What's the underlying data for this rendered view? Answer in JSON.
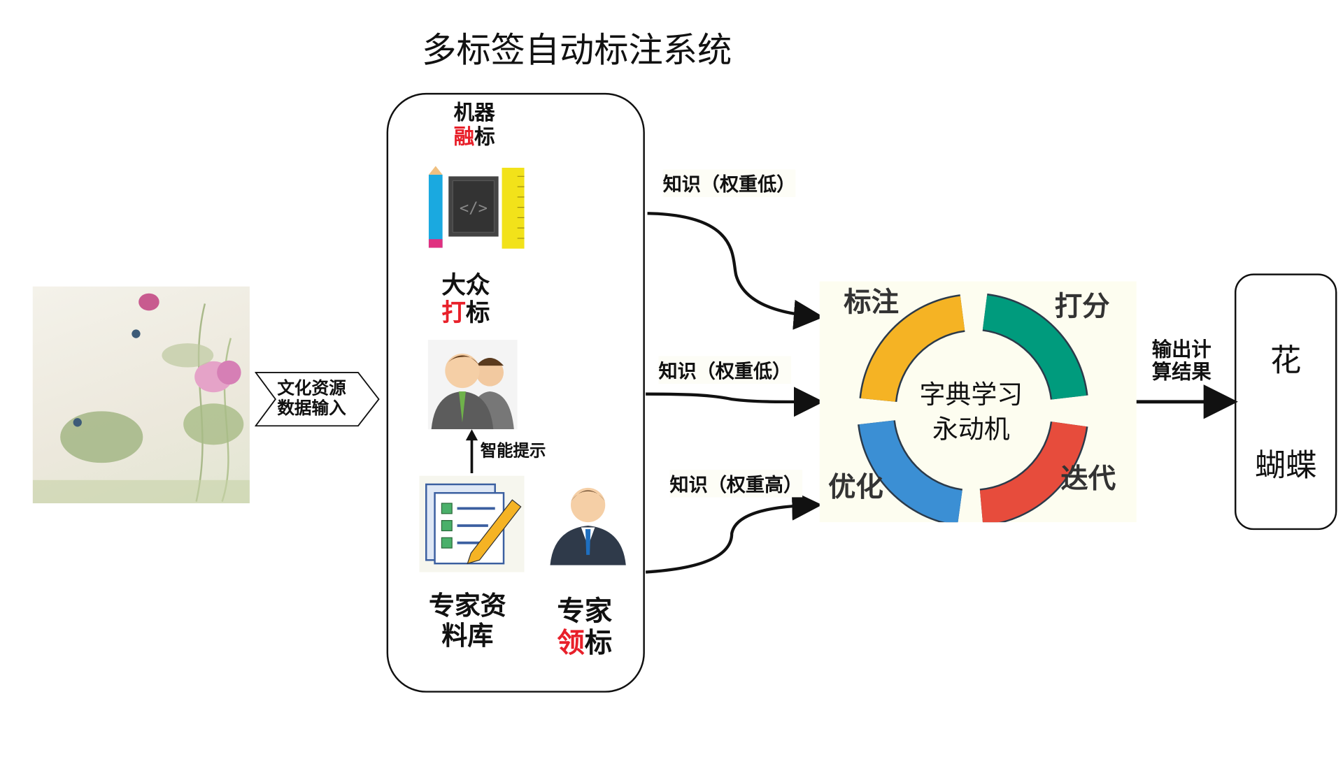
{
  "title": "多标签自动标注系统",
  "input_label": [
    "文化资源",
    "数据输入"
  ],
  "machine": {
    "line1": "机器",
    "line2_red": "融",
    "line2_rest": "标"
  },
  "crowd": {
    "line1": "大众",
    "line2_red": "打",
    "line2_rest": "标"
  },
  "hint": "智能提示",
  "expert_lib": [
    "专家资",
    "料库"
  ],
  "expert": {
    "line1": "专家",
    "line2_red": "领",
    "line2_rest": "标"
  },
  "knowledge": [
    "知识（权重低）",
    "知识（权重低）",
    "知识（权重高）"
  ],
  "cycle": {
    "top_left": "标注",
    "top_right": "打分",
    "bottom_left": "优化",
    "bottom_right": "迭代",
    "center": [
      "字典学习",
      "永动机"
    ],
    "colors": {
      "annotate": "#f5b324",
      "score": "#009b7d",
      "iterate": "#e74c3c",
      "optimize": "#3b8fd4"
    }
  },
  "output_label": [
    "输出计",
    "算结果"
  ],
  "results": [
    "花",
    "蝴蝶"
  ],
  "accent_red": "#e8202a"
}
